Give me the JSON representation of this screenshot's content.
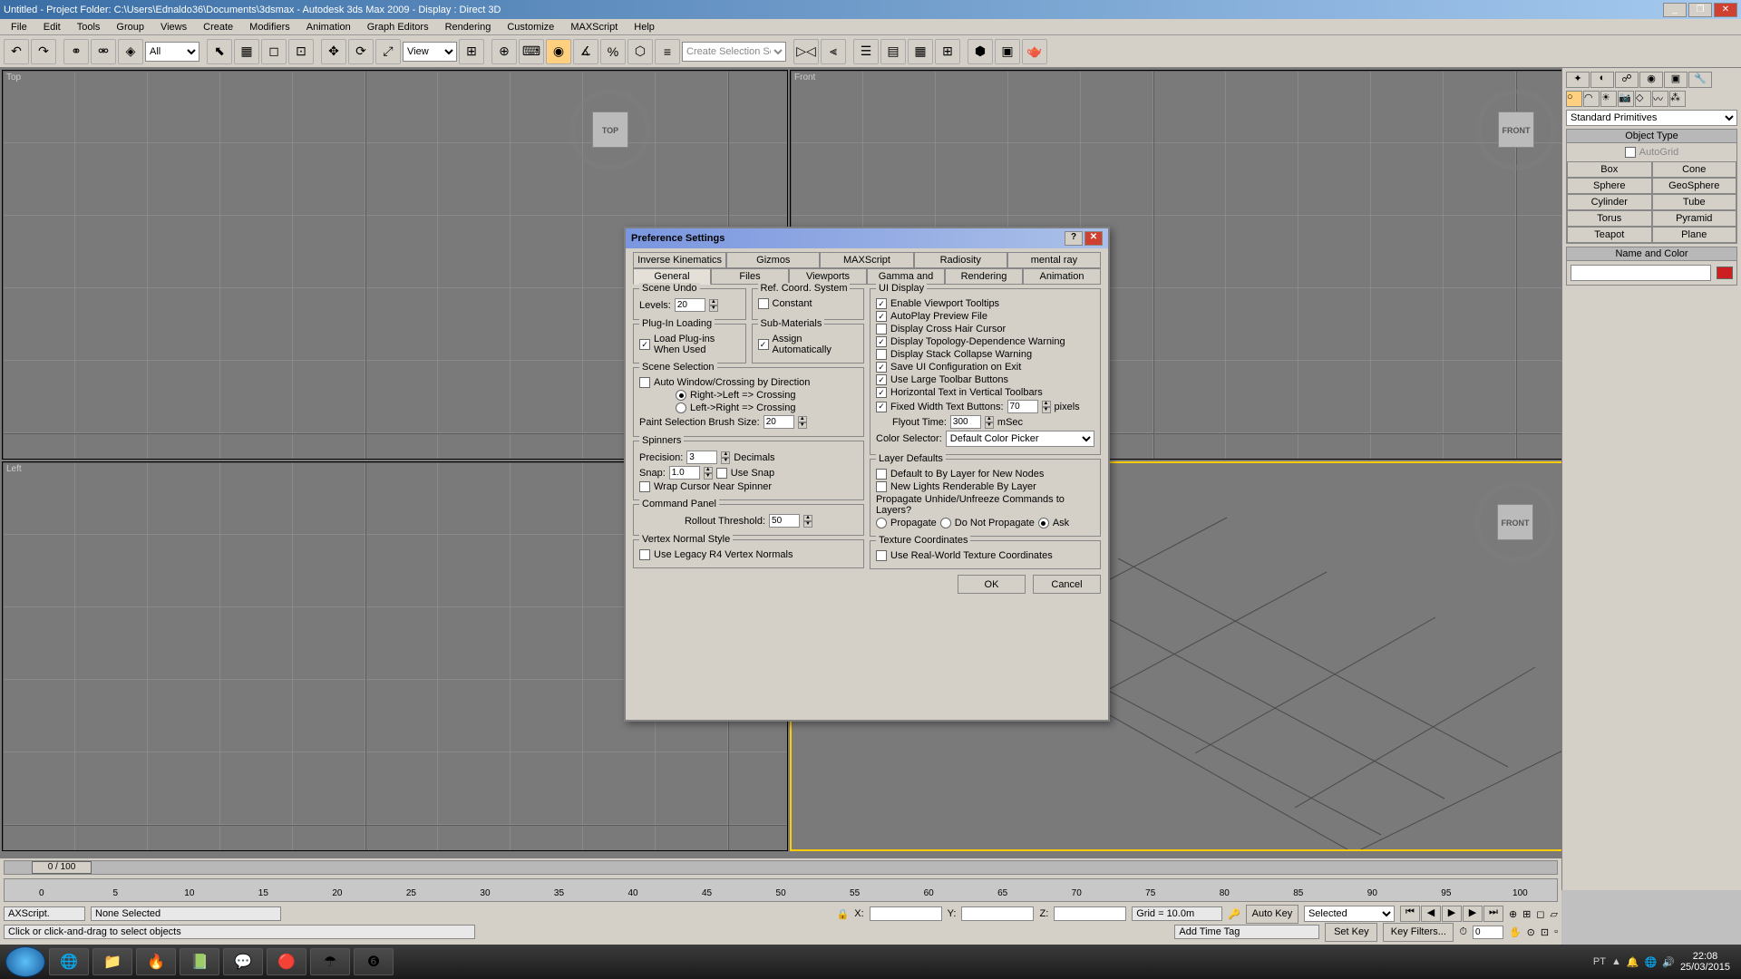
{
  "title": "Untitled  -  Project Folder: C:\\Users\\Ednaldo36\\Documents\\3dsmax  -  Autodesk 3ds Max  2009    -    Display : Direct 3D",
  "menu": [
    "File",
    "Edit",
    "Tools",
    "Group",
    "Views",
    "Create",
    "Modifiers",
    "Animation",
    "Graph Editors",
    "Rendering",
    "Customize",
    "MAXScript",
    "Help"
  ],
  "toolbar": {
    "filter": "All",
    "view": "View",
    "selset": "Create Selection Set"
  },
  "viewports": {
    "tl": "Top",
    "tr": "Front",
    "bl": "Left",
    "br": ""
  },
  "viewcubes": {
    "tl": "TOP",
    "tr": "FRONT",
    "br": "FRONT"
  },
  "panel": {
    "dropdown": "Standard Primitives",
    "objtype": "Object Type",
    "autogrid": "AutoGrid",
    "buttons": [
      "Box",
      "Cone",
      "Sphere",
      "GeoSphere",
      "Cylinder",
      "Tube",
      "Torus",
      "Pyramid",
      "Teapot",
      "Plane"
    ],
    "namecolor": "Name and Color"
  },
  "dialog": {
    "title": "Preference Settings",
    "tabrow1": [
      "Inverse Kinematics",
      "Gizmos",
      "MAXScript",
      "Radiosity",
      "mental ray"
    ],
    "tabrow2": [
      "General",
      "Files",
      "Viewports",
      "Gamma and LUT",
      "Rendering",
      "Animation"
    ],
    "scene_undo": {
      "title": "Scene Undo",
      "levels_lbl": "Levels:",
      "levels": "20"
    },
    "ref_coord": {
      "title": "Ref. Coord. System",
      "constant": "Constant"
    },
    "plugin": {
      "title": "Plug-In Loading",
      "load": "Load Plug-ins When Used"
    },
    "submat": {
      "title": "Sub-Materials",
      "assign": "Assign Automatically"
    },
    "sel": {
      "title": "Scene Selection",
      "auto": "Auto Window/Crossing by Direction",
      "rl": "Right->Left => Crossing",
      "lr": "Left->Right => Crossing",
      "brush_lbl": "Paint Selection Brush Size:",
      "brush": "20"
    },
    "spinners": {
      "title": "Spinners",
      "prec_lbl": "Precision:",
      "prec": "3",
      "dec": "Decimals",
      "snap_lbl": "Snap:",
      "snap": "1.0",
      "usesnap": "Use Snap",
      "wrap": "Wrap Cursor Near Spinner"
    },
    "cmdpanel": {
      "title": "Command Panel",
      "roll_lbl": "Rollout Threshold:",
      "roll": "50"
    },
    "vns": {
      "title": "Vertex Normal Style",
      "legacy": "Use Legacy R4 Vertex Normals"
    },
    "uidisp": {
      "title": "UI Display",
      "tooltips": "Enable Viewport Tooltips",
      "autoplay": "AutoPlay Preview File",
      "crosshair": "Display Cross Hair Cursor",
      "topo": "Display Topology-Dependence Warning",
      "stack": "Display Stack Collapse Warning",
      "saveui": "Save UI Configuration on Exit",
      "large": "Use Large Toolbar Buttons",
      "horiz": "Horizontal Text in Vertical Toolbars",
      "fixed": "Fixed Width Text Buttons:",
      "fixedv": "70",
      "px": "pixels",
      "flyout_lbl": "Flyout Time:",
      "flyout": "300",
      "msec": "mSec",
      "colorsel_lbl": "Color Selector:",
      "colorsel": "Default Color Picker"
    },
    "layer": {
      "title": "Layer Defaults",
      "def": "Default to By Layer for New Nodes",
      "lights": "New Lights Renderable By Layer",
      "prop": "Propagate Unhide/Unfreeze Commands to Layers?",
      "propagate": "Propagate",
      "donot": "Do Not Propagate",
      "ask": "Ask"
    },
    "tex": {
      "title": "Texture Coordinates",
      "rw": "Use Real-World Texture Coordinates"
    },
    "ok": "OK",
    "cancel": "Cancel"
  },
  "bottom": {
    "frame": "0 / 100",
    "none": "None Selected",
    "hint": "Click or click-and-drag to select objects",
    "script": "AXScript.",
    "x": "X:",
    "y": "Y:",
    "z": "Z:",
    "grid": "Grid = 10.0m",
    "autokey": "Auto Key",
    "setkey": "Set Key",
    "selected": "Selected",
    "keyf": "Key Filters...",
    "addtag": "Add Time Tag",
    "spinv": "0"
  },
  "tray": {
    "lang": "PT",
    "time": "22:08",
    "date": "25/03/2015"
  },
  "ruler": [
    0,
    5,
    10,
    15,
    20,
    25,
    30,
    35,
    40,
    45,
    50,
    55,
    60,
    65,
    70,
    75,
    80,
    85,
    90,
    95,
    100
  ]
}
